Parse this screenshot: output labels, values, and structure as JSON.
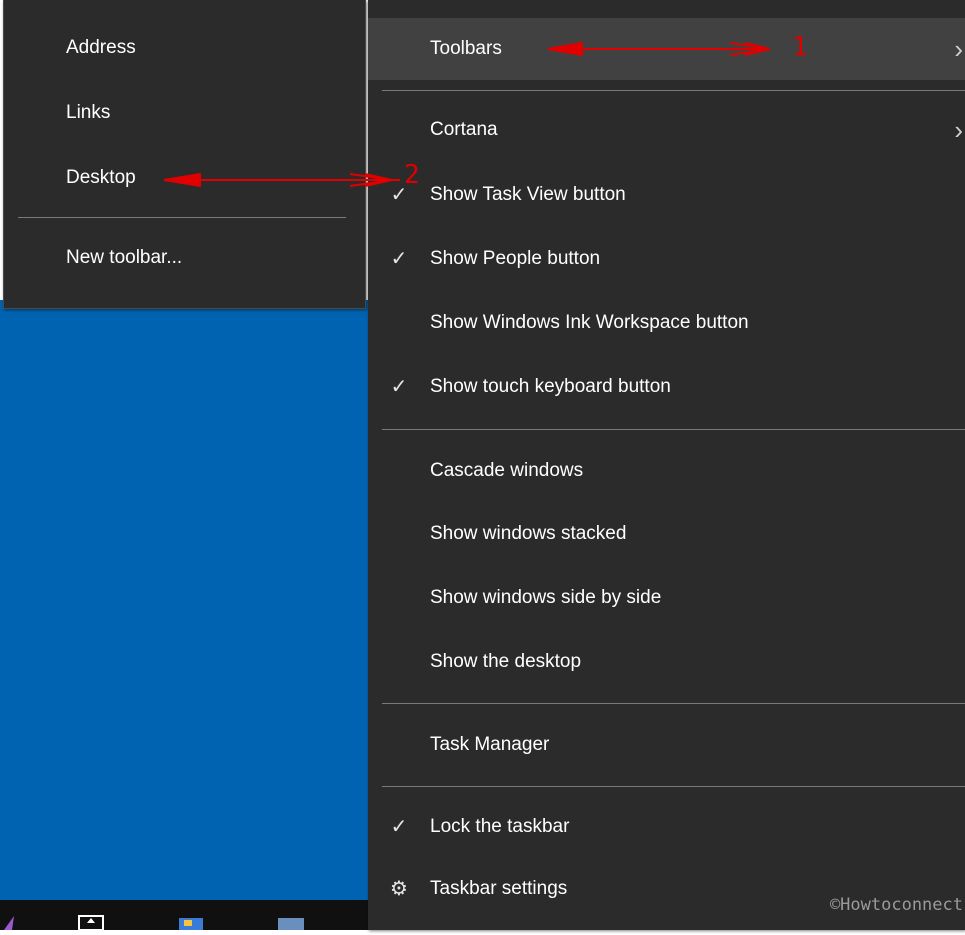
{
  "sub_menu": {
    "items": [
      {
        "label": "Address"
      },
      {
        "label": "Links"
      },
      {
        "label": "Desktop"
      },
      {
        "label": "New toolbar..."
      }
    ]
  },
  "main_menu": {
    "items": [
      {
        "label": "Toolbars",
        "checked": false,
        "has_submenu": true,
        "highlighted": true
      },
      {
        "label": "Cortana",
        "checked": false,
        "has_submenu": true
      },
      {
        "label": "Show Task View button",
        "checked": true
      },
      {
        "label": "Show People button",
        "checked": true
      },
      {
        "label": "Show Windows Ink Workspace button",
        "checked": false
      },
      {
        "label": "Show touch keyboard button",
        "checked": true
      },
      {
        "label": "Cascade windows"
      },
      {
        "label": "Show windows stacked"
      },
      {
        "label": "Show windows side by side"
      },
      {
        "label": "Show the desktop"
      },
      {
        "label": "Task Manager"
      },
      {
        "label": "Lock the taskbar",
        "checked": true
      },
      {
        "label": "Taskbar settings",
        "icon": "gear-icon"
      }
    ]
  },
  "annotations": {
    "step1": "1",
    "step2": "2"
  },
  "watermark": "©Howtoconnect",
  "glyphs": {
    "check": "✓",
    "chevron": "›",
    "gear": "⚙"
  },
  "colors": {
    "menu_bg": "#2b2b2b",
    "highlight": "#414141",
    "desktop": "#0063b1",
    "arrow": "#e00000"
  }
}
